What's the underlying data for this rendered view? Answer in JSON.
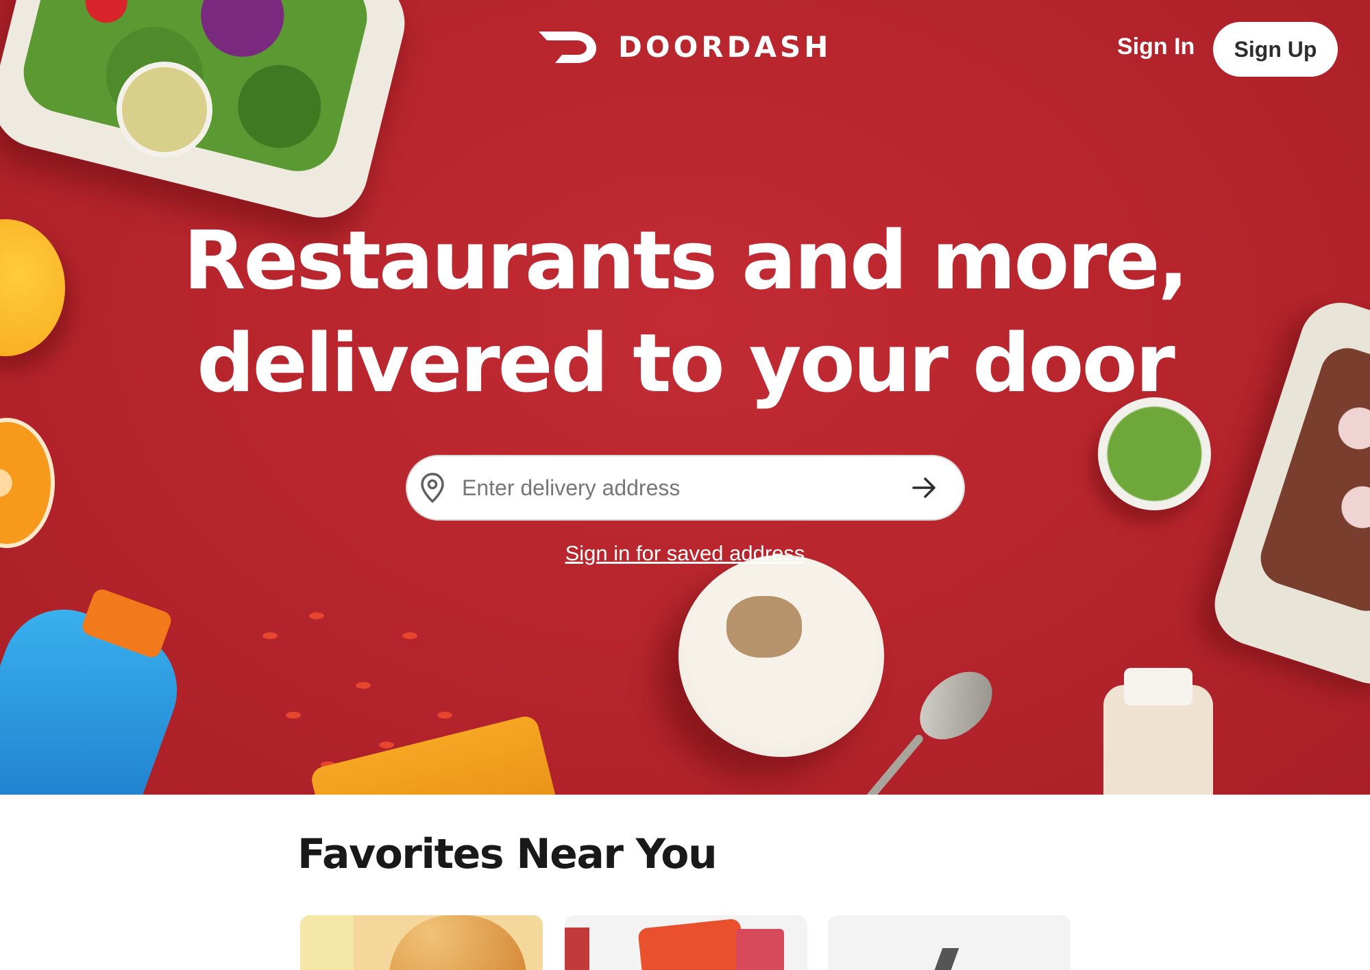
{
  "brand": {
    "name": "DOORDASH",
    "accent": "#b8252d"
  },
  "header": {
    "sign_in_label": "Sign In",
    "sign_up_label": "Sign Up"
  },
  "hero": {
    "headline_line1": "Restaurants and more,",
    "headline_line2": "delivered to your door",
    "address_placeholder": "Enter delivery address",
    "address_value": "",
    "saved_address_link": "Sign in for saved address",
    "icons": {
      "location": "location-pin-icon",
      "submit": "arrow-right-icon"
    }
  },
  "favorites": {
    "title": "Favorites Near You",
    "cards": [
      {
        "image": "burger-image"
      },
      {
        "image": "snacks-drinks-image"
      },
      {
        "image": "store-image"
      }
    ]
  }
}
